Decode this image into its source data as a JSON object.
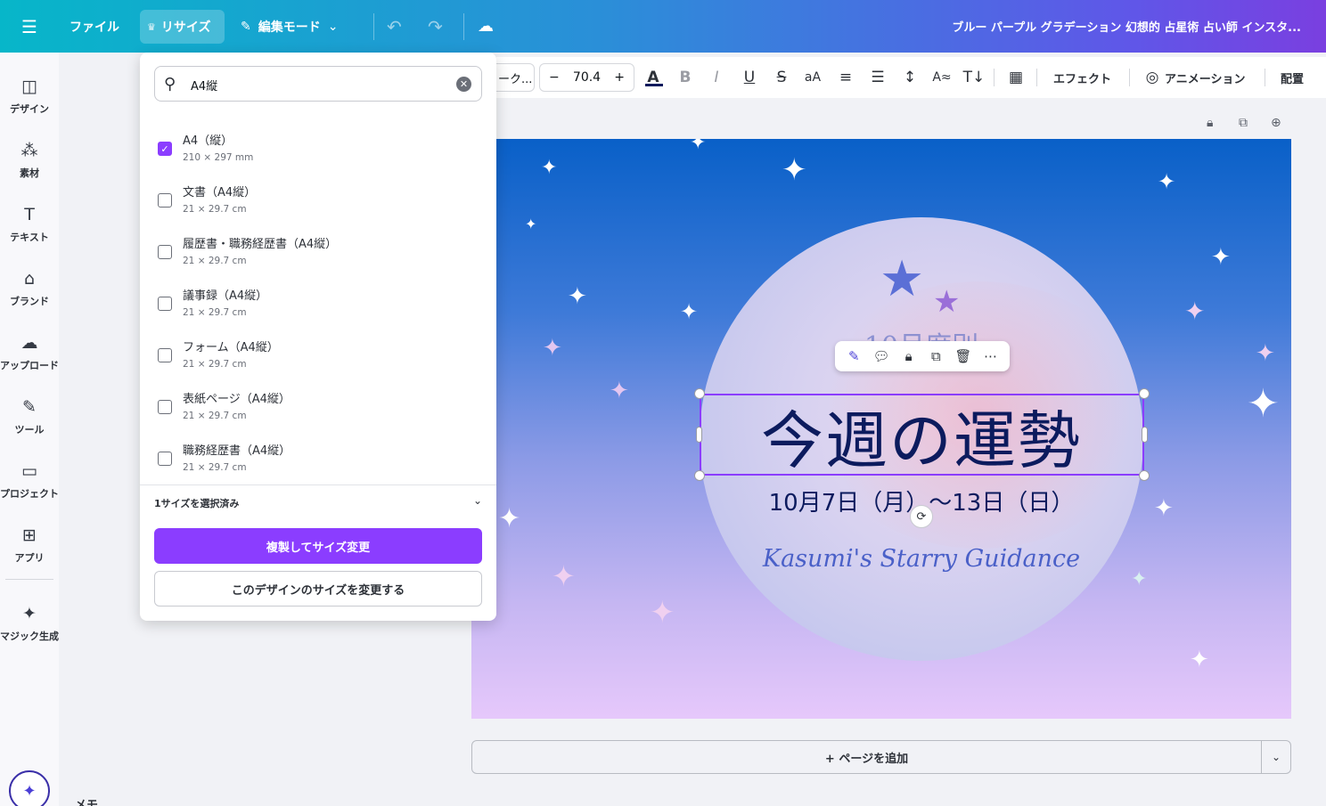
{
  "topbar": {
    "file_label": "ファイル",
    "resize_label": "リサイズ",
    "edit_mode_label": "編集モード",
    "document_title": "ブルー パープル グラデーション 幻想的 占星術 占い師 インスタ..."
  },
  "sidebar": {
    "items": [
      {
        "label": "デザイン",
        "icon": "layout-icon"
      },
      {
        "label": "素材",
        "icon": "elements-icon"
      },
      {
        "label": "テキスト",
        "icon": "text-icon"
      },
      {
        "label": "ブランド",
        "icon": "brand-icon"
      },
      {
        "label": "アップロード",
        "icon": "upload-cloud-icon"
      },
      {
        "label": "ツール",
        "icon": "pen-tool-icon"
      },
      {
        "label": "プロジェクト",
        "icon": "folder-icon"
      },
      {
        "label": "アプリ",
        "icon": "apps-grid-icon"
      },
      {
        "label": "マジック生成",
        "icon": "magic-image-icon"
      }
    ]
  },
  "text_toolbar": {
    "font_name_partial": "ーク...",
    "font_size": "70.4",
    "effects_label": "エフェクト",
    "animation_label": "アニメーション",
    "position_label": "配置"
  },
  "resize_panel": {
    "search_value": "A4縦",
    "options": [
      {
        "title": "A4（縦）",
        "size": "210 × 297 mm",
        "checked": true
      },
      {
        "title": "文書（A4縦）",
        "size": "21 × 29.7 cm",
        "checked": false
      },
      {
        "title": "履歴書・職務経歴書（A4縦）",
        "size": "21 × 29.7 cm",
        "checked": false
      },
      {
        "title": "議事録（A4縦）",
        "size": "21 × 29.7 cm",
        "checked": false
      },
      {
        "title": "フォーム（A4縦）",
        "size": "21 × 29.7 cm",
        "checked": false
      },
      {
        "title": "表紙ページ（A4縦）",
        "size": "21 × 29.7 cm",
        "checked": false
      },
      {
        "title": "職務経歴書（A4縦）",
        "size": "21 × 29.7 cm",
        "checked": false
      }
    ],
    "selected_count_label": "1サイズを選択済み",
    "copy_resize_button": "複製してサイズ変更",
    "resize_this_button": "このデザインのサイズを変更する"
  },
  "canvas": {
    "month_label": "10月度別",
    "headline": "今週の運勢",
    "dates": "10月7日（月）～13日（日）",
    "script_text": "Kasumi's Starry Guidance",
    "colors": {
      "headline": "#0c1b5e",
      "selection": "#8b3dff",
      "gradient_top": "#0960c8",
      "gradient_bottom": "#e6c8fb"
    }
  },
  "bottom": {
    "add_page_label": "+ ページを追加",
    "notes_label": "メモ"
  }
}
